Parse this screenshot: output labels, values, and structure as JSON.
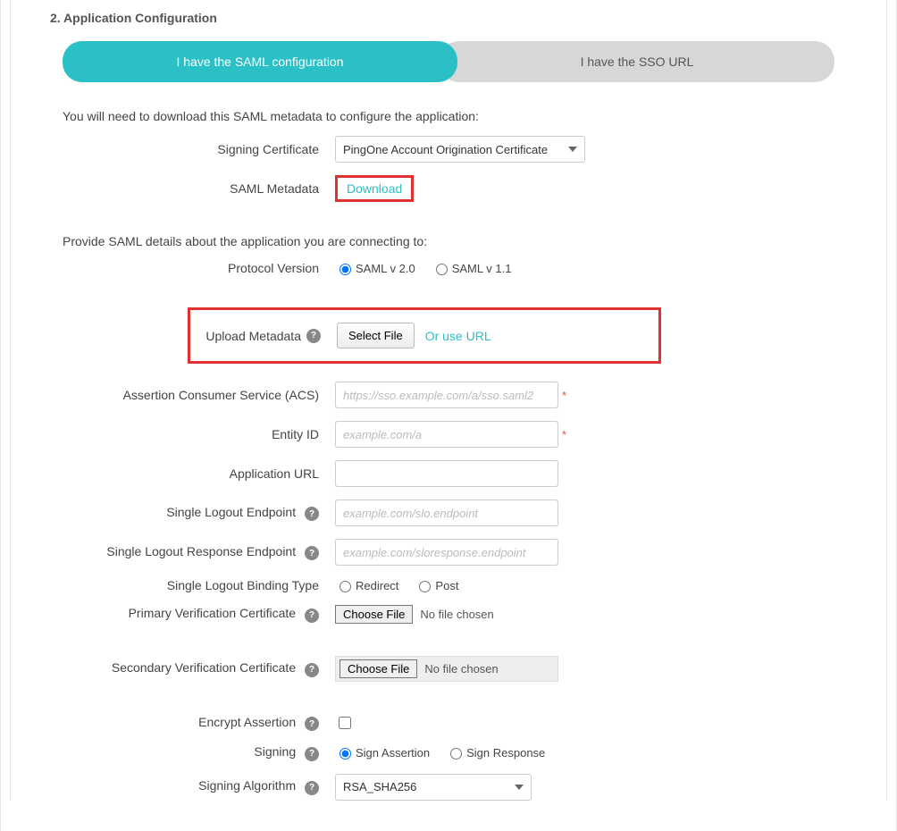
{
  "section_title": "2. Application Configuration",
  "tabs": {
    "saml_config": "I have the SAML configuration",
    "sso_url": "I have the SSO URL"
  },
  "intro1": "You will need to download this SAML metadata to configure the application:",
  "intro2": "Provide SAML details about the application you are connecting to:",
  "labels": {
    "signing_cert": "Signing Certificate",
    "saml_metadata": "SAML Metadata",
    "protocol_version": "Protocol Version",
    "upload_metadata": "Upload Metadata",
    "acs": "Assertion Consumer Service (ACS)",
    "entity_id": "Entity ID",
    "app_url": "Application URL",
    "slo_endpoint": "Single Logout Endpoint",
    "slo_response": "Single Logout Response Endpoint",
    "slo_binding": "Single Logout Binding Type",
    "primary_cert": "Primary Verification Certificate",
    "secondary_cert": "Secondary Verification Certificate",
    "encrypt": "Encrypt Assertion",
    "signing": "Signing",
    "signing_algorithm": "Signing Algorithm"
  },
  "values": {
    "signing_cert_selected": "PingOne Account Origination Certificate",
    "signing_algorithm_selected": "RSA_SHA256"
  },
  "actions": {
    "download": "Download",
    "select_file": "Select File",
    "or_use_url": "Or use URL",
    "choose_file": "Choose File",
    "no_file": "No file chosen"
  },
  "placeholders": {
    "acs": "https://sso.example.com/a/sso.saml2",
    "entity_id": "example.com/a",
    "slo_endpoint": "example.com/slo.endpoint",
    "slo_response": "example.com/sloresponse.endpoint"
  },
  "options": {
    "protocol_v20": "SAML v 2.0",
    "protocol_v11": "SAML v 1.1",
    "binding_redirect": "Redirect",
    "binding_post": "Post",
    "sign_assertion": "Sign Assertion",
    "sign_response": "Sign Response"
  },
  "help_glyph": "?"
}
